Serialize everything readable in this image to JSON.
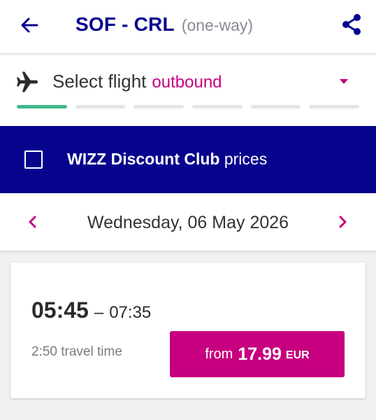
{
  "header": {
    "route": "SOF - CRL",
    "trip_type": "(one-way)",
    "back_icon": "arrow-left-icon",
    "share_icon": "share-icon"
  },
  "selector": {
    "icon": "plane-icon",
    "label": "Select flight",
    "direction": "outbound",
    "progress": {
      "steps_total": 6,
      "steps_done": 1
    }
  },
  "discount_club": {
    "checked": false,
    "brand": "WIZZ Discount Club",
    "suffix": "prices"
  },
  "date_nav": {
    "date": "Wednesday, 06 May 2026"
  },
  "flight": {
    "departure": "05:45",
    "separator": "–",
    "arrival": "07:35",
    "travel_time": "2:50 travel time",
    "price_prefix": "from",
    "price": "17.99",
    "currency": "EUR"
  },
  "colors": {
    "primary": "#06038d",
    "accent": "#c6007e",
    "progress_done": "#3db98a",
    "progress_todo": "#e4e4e8",
    "background": "#f1f1f4"
  }
}
